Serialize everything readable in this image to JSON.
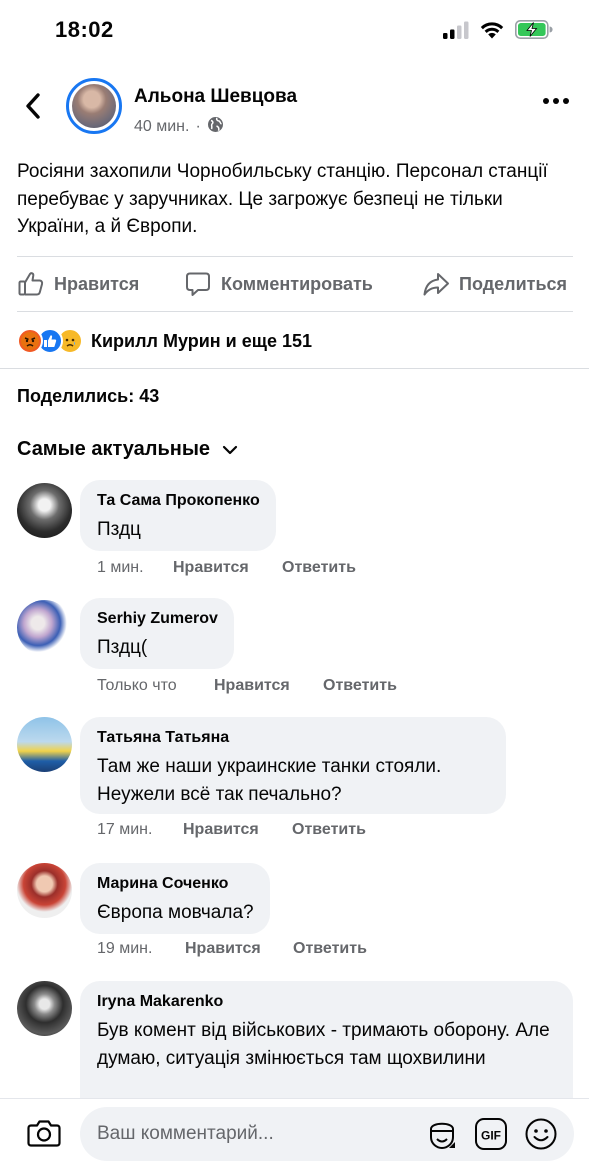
{
  "status_bar": {
    "time": "18:02"
  },
  "post": {
    "author": "Альона Шевцова",
    "time": "40 мин.",
    "separator": "·",
    "text": "Росіяни захопили Чорнобильську станцію. Персонал станції перебуває у заручниках. Це загрожує безпеці не тільки України, а й Європи."
  },
  "actions": {
    "like": "Нравится",
    "comment": "Комментировать",
    "share": "Поделиться"
  },
  "reactions": {
    "icons": [
      "angry-icon",
      "like-icon",
      "sad-icon"
    ],
    "summary": "Кирилл Мурин и еще 151"
  },
  "shares": "Поделились: 43",
  "sort_label": "Самые актуальные",
  "comments": [
    {
      "name": "Та Сама Прокопенко",
      "text": "Пздц",
      "time": "1 мин.",
      "like": "Нравится",
      "reply": "Ответить"
    },
    {
      "name": "Serhiy Zumerov",
      "text": "Пздц(",
      "time": "Только что",
      "like": "Нравится",
      "reply": "Ответить"
    },
    {
      "name": "Татьяна Татьяна",
      "text": "Там же наши украинские танки стояли. Неужели всё так печально?",
      "time": "17 мин.",
      "like": "Нравится",
      "reply": "Ответить"
    },
    {
      "name": "Марина Соченко",
      "text": "Європа мовчала?",
      "time": "19 мин.",
      "like": "Нравится",
      "reply": "Ответить"
    },
    {
      "name": "Iryna Makarenko",
      "text": "Був комент від військових - тримають оборону. Але думаю, ситуація змінюється там щохвилини"
    }
  ],
  "composer": {
    "placeholder": "Ваш комментарий..."
  },
  "colors": {
    "accent": "#1877f2",
    "bubble": "#f0f2f5",
    "secondary_text": "#65676b",
    "battery": "#34c759"
  }
}
